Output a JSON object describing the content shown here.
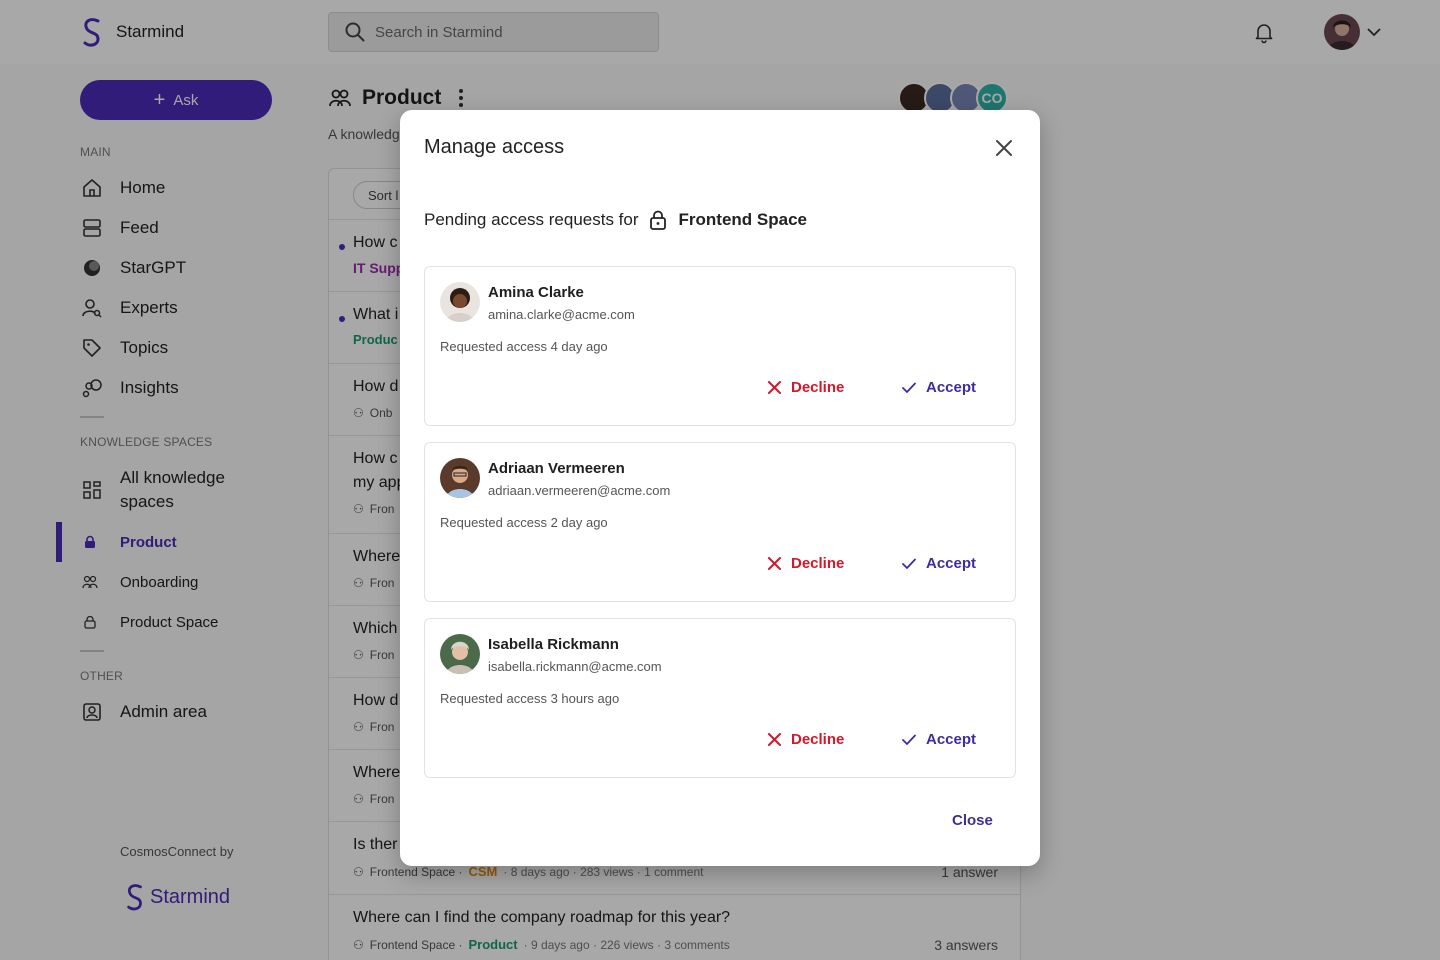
{
  "app": {
    "brand": "Starmind",
    "search_placeholder": "Search in Starmind",
    "footer_by": "CosmosConnect by",
    "footer_brand": "Starmind"
  },
  "sidebar": {
    "ask_label": "Ask",
    "main_label": "MAIN",
    "main_items": [
      {
        "label": "Home",
        "icon": "home-icon"
      },
      {
        "label": "Feed",
        "icon": "feed-icon"
      },
      {
        "label": "StarGPT",
        "icon": "stargpt-icon"
      },
      {
        "label": "Experts",
        "icon": "experts-icon"
      },
      {
        "label": "Topics",
        "icon": "tag-icon"
      },
      {
        "label": "Insights",
        "icon": "insights-icon"
      }
    ],
    "spaces_label": "KNOWLEDGE SPACES",
    "spaces_all_line1": "All knowledge",
    "spaces_all_line2": "spaces",
    "spaces": [
      {
        "label": "Product",
        "icon": "lock-icon",
        "active": true
      },
      {
        "label": "Onboarding",
        "icon": "group-icon",
        "active": false
      },
      {
        "label": "Product Space",
        "icon": "lock-icon",
        "active": false
      }
    ],
    "other_label": "OTHER",
    "admin_label": "Admin area"
  },
  "main": {
    "space_title": "Product",
    "space_desc": "A knowledg",
    "member_badge": "CO",
    "sort_label": "Sort l",
    "questions": [
      {
        "title": "How c",
        "meta": "IT Supp"
      },
      {
        "title": "What i",
        "meta": "Produc"
      },
      {
        "title": "How d",
        "meta": "Onb"
      },
      {
        "title": "How c",
        "title2": "my app",
        "meta": "Fron"
      },
      {
        "title": "Where",
        "meta": "Fron"
      },
      {
        "title": "Which",
        "meta": "Fron"
      },
      {
        "title": "How d",
        "meta": "Fron"
      },
      {
        "title": "Where",
        "meta": "Fron"
      },
      {
        "title": "Is ther",
        "space": "Frontend Space ·",
        "tag": "CSM",
        "meta": "· 8 days ago · 283 views · 1 comment",
        "answers": "1 answer"
      },
      {
        "title": "Where can I find the company roadmap for this year?",
        "space": "Frontend Space ·",
        "tag": "Product",
        "meta": "· 9 days ago · 226 views · 3 comments",
        "answers": "3 answers"
      }
    ]
  },
  "modal": {
    "title": "Manage access",
    "pending_prefix": "Pending access requests for",
    "space_name": "Frontend Space",
    "decline_label": "Decline",
    "accept_label": "Accept",
    "close_label": "Close",
    "requests": [
      {
        "name": "Amina Clarke",
        "email": "amina.clarke@acme.com",
        "time": "Requested access 4 day ago"
      },
      {
        "name": "Adriaan Vermeeren",
        "email": "adriaan.vermeeren@acme.com",
        "time": "Requested access 2 day ago"
      },
      {
        "name": "Isabella Rickmann",
        "email": "isabella.rickmann@acme.com",
        "time": "Requested access 3 hours ago"
      }
    ]
  },
  "colors": {
    "brand": "#4c2bb8",
    "decline": "#d0192b",
    "accept": "#3f2d9c"
  }
}
